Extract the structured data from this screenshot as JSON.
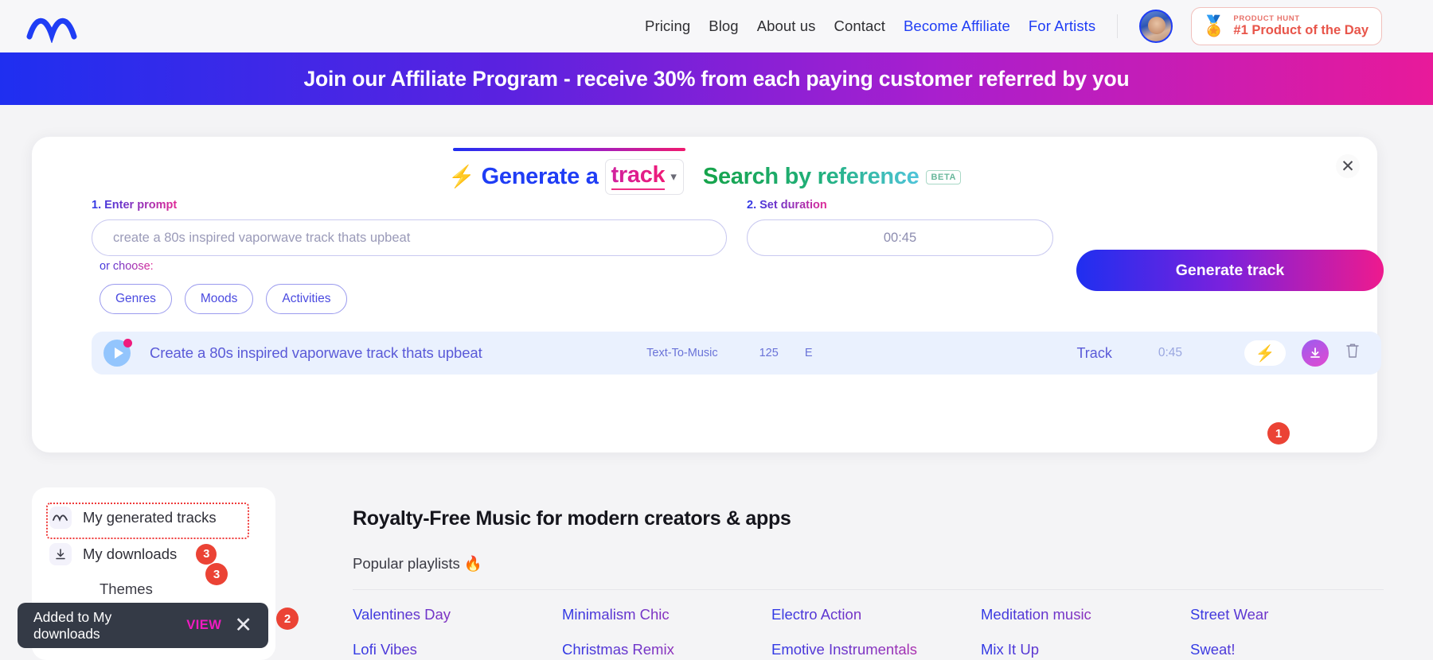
{
  "nav": {
    "logo_icon": "waveform-logo",
    "links": [
      {
        "label": "Pricing",
        "accent": false
      },
      {
        "label": "Blog",
        "accent": false
      },
      {
        "label": "About us",
        "accent": false
      },
      {
        "label": "Contact",
        "accent": false
      },
      {
        "label": "Become Affiliate",
        "accent": true
      },
      {
        "label": "For Artists",
        "accent": true
      }
    ],
    "product_hunt": {
      "medal_icon": "medal-icon",
      "top_label": "PRODUCT HUNT",
      "main_label": "#1 Product of the Day"
    }
  },
  "banner": {
    "text": "Join our Affiliate Program - receive 30% from each paying customer referred by you"
  },
  "generator": {
    "close_icon": "close-icon",
    "tabs": {
      "generate": {
        "bolt_icon": "lightning-bolt-icon",
        "prefix": "Generate a",
        "selected": "track",
        "caret_icon": "chevron-down-icon"
      },
      "search": {
        "label": "Search by reference",
        "badge": "BETA"
      }
    },
    "prompt": {
      "label": "1. Enter prompt",
      "placeholder": "create a 80s inspired vaporwave track thats upbeat",
      "value": ""
    },
    "duration": {
      "label": "2. Set duration",
      "value": "00:45"
    },
    "or_choose": "or choose:",
    "chips": [
      "Genres",
      "Moods",
      "Activities"
    ],
    "generate_button": "Generate track",
    "track_row": {
      "play_icon": "play-icon",
      "title": "Create a 80s inspired vaporwave track thats upbeat",
      "type": "Text-To-Music",
      "bpm": "125",
      "key": "E",
      "kind": "Track",
      "duration": "0:45",
      "bolt_icon": "lightning-bolt-icon",
      "download_icon": "download-icon",
      "trash_icon": "trash-icon"
    }
  },
  "markers": {
    "one": "1",
    "two": "2",
    "three": "3"
  },
  "sidebar": {
    "items": [
      {
        "label": "My generated tracks",
        "icon": "waveform-icon",
        "badge": ""
      },
      {
        "label": "My downloads",
        "icon": "download-icon",
        "badge": "3"
      }
    ],
    "themes_label": "Themes"
  },
  "main": {
    "title": "Royalty-Free Music for modern creators & apps",
    "subtitle": "Popular playlists 🔥",
    "playlists": [
      "Valentines Day",
      "Minimalism Chic",
      "Electro Action",
      "Meditation music",
      "Street Wear",
      "Lofi Vibes",
      "Christmas Remix",
      "Emotive Instrumentals",
      "Mix It Up",
      "Sweat!"
    ]
  },
  "toast": {
    "message": "Added to My downloads",
    "action": "VIEW",
    "close_icon": "close-icon"
  }
}
